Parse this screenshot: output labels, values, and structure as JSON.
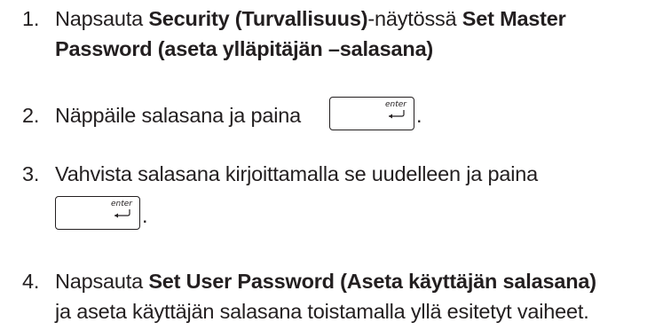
{
  "steps": [
    {
      "number": "1.",
      "line1": {
        "p1": "Napsauta ",
        "b1": "Security (Turvallisuus)",
        "p2": "-näytössä ",
        "b2": "Set Master"
      },
      "line2": {
        "b1": "Password (aseta ylläpitäjän –salasana)"
      }
    },
    {
      "number": "2.",
      "text": "Näppäile salasana ja paina",
      "end": "."
    },
    {
      "number": "3.",
      "text": "Vahvista salasana kirjoittamalla se uudelleen ja paina",
      "end": "."
    },
    {
      "number": "4.",
      "line1": {
        "p1": "Napsauta ",
        "b1": "Set User Password (Aseta käyttäjän salasana)"
      },
      "line2": "ja aseta käyttäjän salasana toistamalla yllä esitetyt vaiheet."
    }
  ],
  "enter_key": {
    "label": "enter",
    "icon": "enter-arrow-icon"
  }
}
